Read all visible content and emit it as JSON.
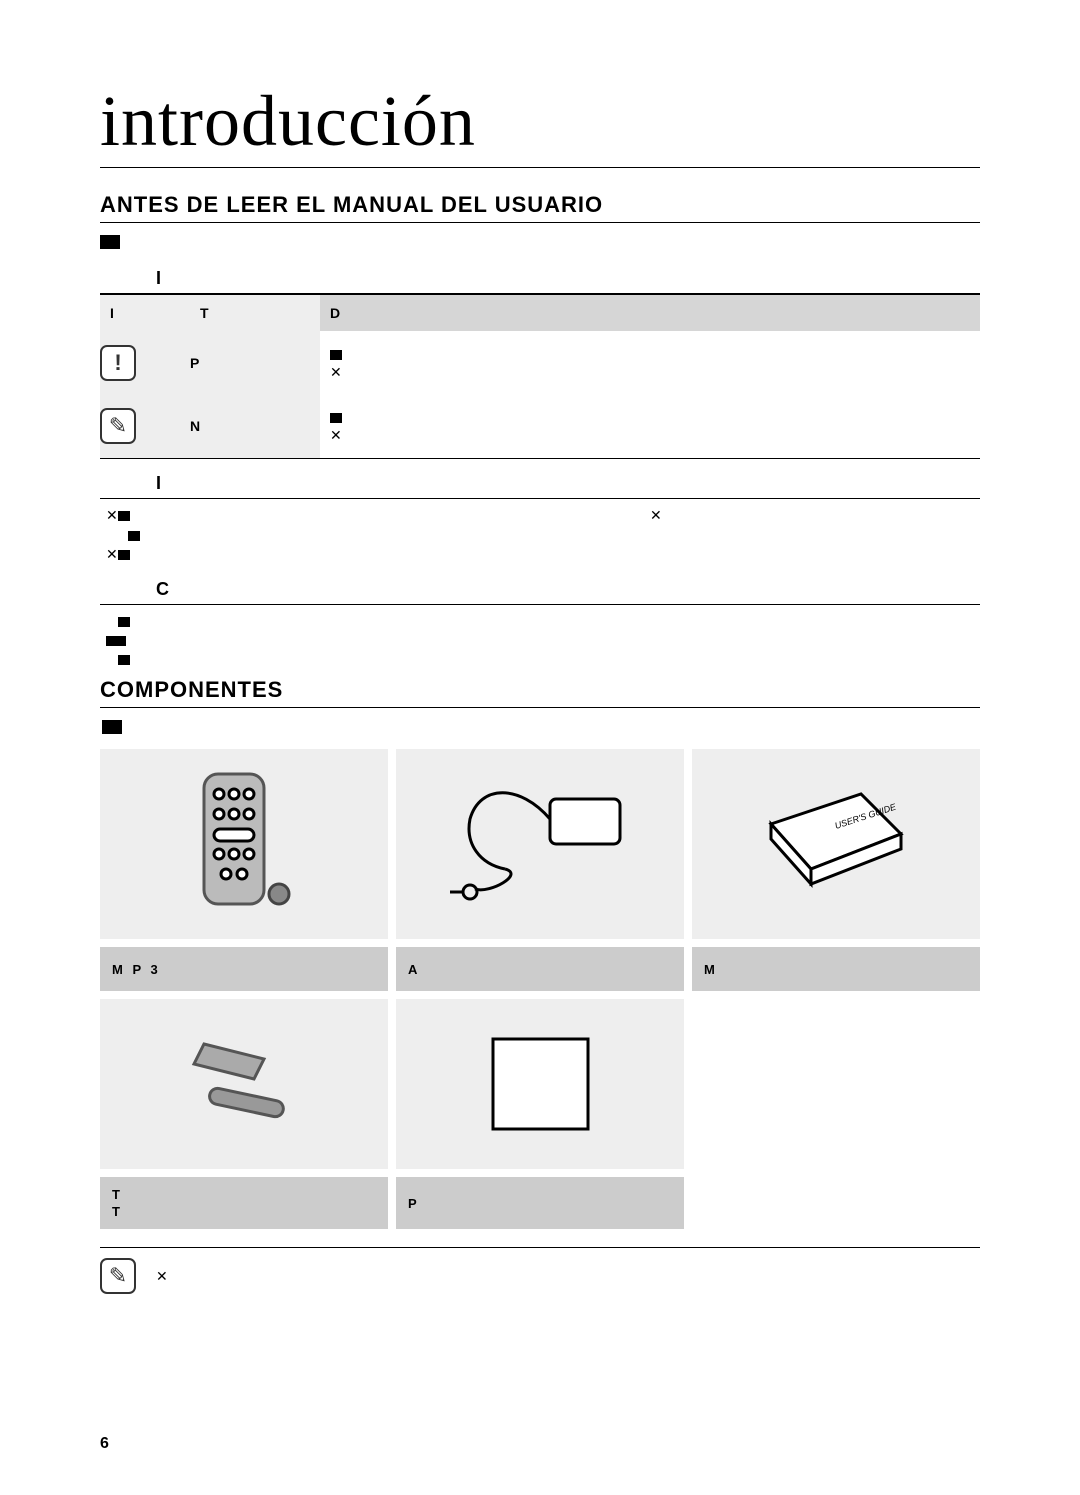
{
  "title": "introducción",
  "section1": {
    "heading": "ANTES DE LEER EL MANUAL DEL USUARIO",
    "sub_icons": "I",
    "table": {
      "headers": {
        "icon": "I",
        "term": "T",
        "def": "D"
      },
      "rows": [
        {
          "term": "P",
          "def1": "",
          "def2": ""
        },
        {
          "term": "N",
          "def1": "",
          "def2": ""
        }
      ]
    },
    "sub_i": "I",
    "sub_c": "C"
  },
  "section2": {
    "heading": "COMPONENTES",
    "items": [
      {
        "label": "M  P 3"
      },
      {
        "label": "A"
      },
      {
        "label": "M"
      },
      {
        "label_line1": "T",
        "label_line2": "T"
      },
      {
        "label": "P"
      }
    ]
  },
  "footnote_text": "",
  "page_number": "6"
}
